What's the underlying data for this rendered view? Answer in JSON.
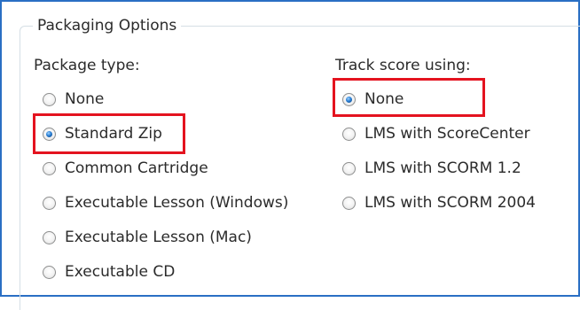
{
  "group": {
    "title": "Packaging Options"
  },
  "package_type": {
    "title": "Package type:",
    "options": [
      {
        "label": "None",
        "checked": false
      },
      {
        "label": "Standard Zip",
        "checked": true
      },
      {
        "label": "Common Cartridge",
        "checked": false
      },
      {
        "label": "Executable Lesson (Windows)",
        "checked": false
      },
      {
        "label": "Executable Lesson (Mac)",
        "checked": false
      },
      {
        "label": "Executable CD",
        "checked": false
      }
    ]
  },
  "track_score": {
    "title": "Track score using:",
    "options": [
      {
        "label": "None",
        "checked": true
      },
      {
        "label": "LMS with ScoreCenter",
        "checked": false
      },
      {
        "label": "LMS with SCORM 1.2",
        "checked": false
      },
      {
        "label": "LMS with SCORM 2004",
        "checked": false
      }
    ]
  },
  "colors": {
    "frame_border": "#2a6fc4",
    "highlight": "#e4131f",
    "radio_selected": "#2a7fd4"
  }
}
